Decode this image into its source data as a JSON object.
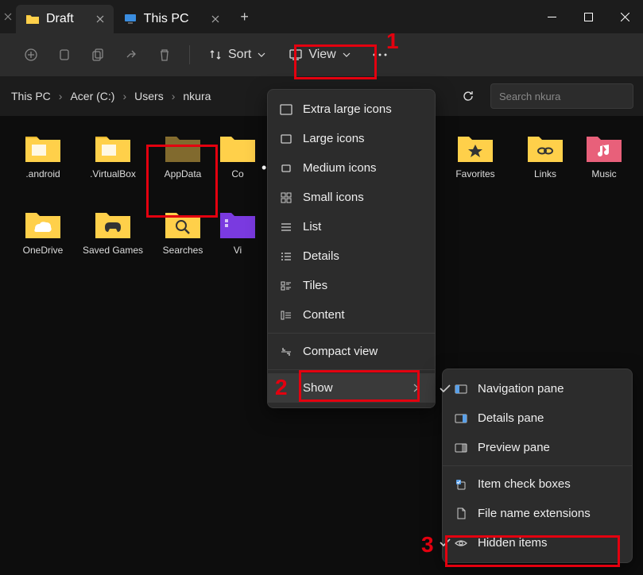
{
  "titlebar": {
    "tabs": [
      {
        "label": "Draft",
        "icon": "folder",
        "active": true
      },
      {
        "label": "This PC",
        "icon": "pc",
        "active": false
      }
    ]
  },
  "toolbar": {
    "sort_label": "Sort",
    "view_label": "View"
  },
  "breadcrumbs": {
    "items": [
      "This PC",
      "Acer (C:)",
      "Users",
      "nkura"
    ]
  },
  "search": {
    "placeholder": "Search nkura"
  },
  "folders": [
    {
      "name": ".android",
      "type": "folder"
    },
    {
      "name": ".VirtualBox",
      "type": "folder"
    },
    {
      "name": "AppData",
      "type": "folder-hidden"
    },
    {
      "name": "Contacts",
      "type": "folder-partial"
    },
    {
      "name": "Favorites",
      "type": "folder-star"
    },
    {
      "name": "Links",
      "type": "folder-link"
    },
    {
      "name": "Music",
      "type": "folder-music"
    },
    {
      "name": "OneDrive",
      "type": "folder"
    },
    {
      "name": "Saved Games",
      "type": "folder-games"
    },
    {
      "name": "Searches",
      "type": "folder-search"
    },
    {
      "name": "Videos",
      "type": "folder-video"
    }
  ],
  "view_menu": {
    "items": [
      {
        "label": "Extra large icons",
        "icon": "rect-xl"
      },
      {
        "label": "Large icons",
        "icon": "rect-lg"
      },
      {
        "label": "Medium icons",
        "icon": "rect-md",
        "selected": true
      },
      {
        "label": "Small icons",
        "icon": "grid-sm"
      },
      {
        "label": "List",
        "icon": "list"
      },
      {
        "label": "Details",
        "icon": "details"
      },
      {
        "label": "Tiles",
        "icon": "tiles"
      },
      {
        "label": "Content",
        "icon": "content"
      }
    ],
    "compact_label": "Compact view",
    "show_label": "Show"
  },
  "show_submenu": {
    "items": [
      {
        "label": "Navigation pane",
        "icon": "pane-nav",
        "checked": true
      },
      {
        "label": "Details pane",
        "icon": "pane-details"
      },
      {
        "label": "Preview pane",
        "icon": "pane-preview"
      },
      {
        "label": "Item check boxes",
        "icon": "checkbox-icon"
      },
      {
        "label": "File name extensions",
        "icon": "file-ext"
      },
      {
        "label": "Hidden items",
        "icon": "eye",
        "checked": true
      }
    ]
  },
  "annotations": {
    "n1": "1",
    "n2": "2",
    "n3": "3"
  }
}
